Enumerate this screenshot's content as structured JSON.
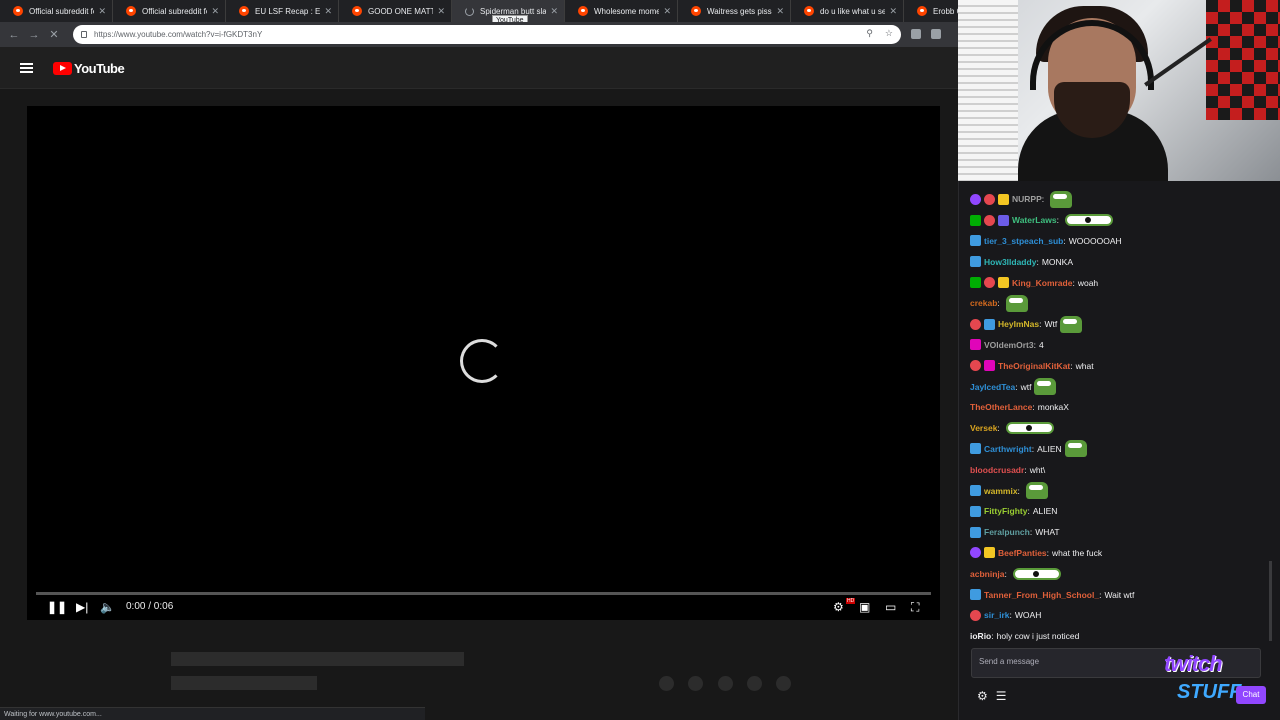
{
  "browser": {
    "tabs": [
      {
        "title": "Official subreddit fo",
        "icon": "reddit-icon",
        "active": false
      },
      {
        "title": "Official subreddit fo",
        "icon": "reddit-icon",
        "active": false
      },
      {
        "title": "EU LSF Recap : Esfa",
        "icon": "reddit-icon",
        "active": false
      },
      {
        "title": "GOOD ONE MATTH",
        "icon": "reddit-icon",
        "active": false
      },
      {
        "title": "Spiderman butt slap",
        "icon": "loading-spinner",
        "active": true
      },
      {
        "title": "Wholesome mome",
        "icon": "reddit-icon",
        "active": false
      },
      {
        "title": "Waitress gets pisse",
        "icon": "reddit-icon",
        "active": false
      },
      {
        "title": "do u like what u se",
        "icon": "reddit-icon",
        "active": false
      },
      {
        "title": "Erobb C",
        "icon": "reddit-icon",
        "active": false
      }
    ],
    "tooltip": "YouTube",
    "url": "https://www.youtube.com/watch?v=i-fGKDT3nY",
    "status": "Waiting for www.youtube.com..."
  },
  "youtube": {
    "logo_text": "YouTube",
    "player": {
      "time": "0:00 / 0:06",
      "progress": 0,
      "hd_badge": "HD"
    }
  },
  "chat": {
    "messages": [
      {
        "user": "NURPP",
        "color": "#9e9e9e",
        "badges": [
          "b-prime",
          "b-g",
          "b-bits"
        ],
        "text": "",
        "emote": "emote"
      },
      {
        "user": "WaterLaws",
        "color": "#3fbf7f",
        "badges": [
          "b-mod",
          "b-g",
          "b-gift"
        ],
        "text": "",
        "emote": "emote-wide"
      },
      {
        "user": "tier_3_stpeach_sub",
        "color": "#2e8fd6",
        "badges": [
          "b-sub"
        ],
        "text": "WOOOOOAH",
        "emote": ""
      },
      {
        "user": "How3lldaddy",
        "color": "#2eb6b6",
        "badges": [
          "b-sub"
        ],
        "text": "MONKA",
        "emote": ""
      },
      {
        "user": "King_Komrade",
        "color": "#e0603a",
        "badges": [
          "b-mod",
          "b-g",
          "b-bits"
        ],
        "text": "woah",
        "emote": ""
      },
      {
        "user": "crekab",
        "color": "#d2691e",
        "badges": [],
        "text": "",
        "emote": "emote"
      },
      {
        "user": "HeyImNas",
        "color": "#d4b72a",
        "badges": [
          "b-g",
          "b-sub"
        ],
        "text": "Wtf",
        "emote": "emote"
      },
      {
        "user": "VOldemOrt3",
        "color": "#9e9e9e",
        "badges": [
          "b-vip"
        ],
        "text": "4",
        "emote": ""
      },
      {
        "user": "TheOriginalKitKat",
        "color": "#e0603a",
        "badges": [
          "b-g",
          "b-vip"
        ],
        "text": "what",
        "emote": ""
      },
      {
        "user": "JayIcedTea",
        "color": "#2e8fd6",
        "badges": [],
        "text": "wtf",
        "emote": "emote"
      },
      {
        "user": "TheOtherLance",
        "color": "#e0603a",
        "badges": [],
        "text": "monkaX",
        "emote": ""
      },
      {
        "user": "Versek",
        "color": "#daa520",
        "badges": [],
        "text": "",
        "emote": "emote-wide"
      },
      {
        "user": "Carthwright",
        "color": "#2e8fd6",
        "badges": [
          "b-sub"
        ],
        "text": "ALIEN",
        "emote": "emote"
      },
      {
        "user": "bloodcrusadr",
        "color": "#e05050",
        "badges": [],
        "text": "wht\\",
        "emote": ""
      },
      {
        "user": "wammix",
        "color": "#d4b72a",
        "badges": [
          "b-sub"
        ],
        "text": "",
        "emote": "emote"
      },
      {
        "user": "FittyFighty",
        "color": "#9acd32",
        "badges": [
          "b-sub"
        ],
        "text": "ALIEN",
        "emote": ""
      },
      {
        "user": "Feralpunch",
        "color": "#5f9ea0",
        "badges": [
          "b-sub"
        ],
        "text": "WHAT",
        "emote": ""
      },
      {
        "user": "BeefPanties",
        "color": "#e0603a",
        "badges": [
          "b-prime",
          "b-bits"
        ],
        "text": "what the fuck",
        "emote": ""
      },
      {
        "user": "acbninja",
        "color": "#e0603a",
        "badges": [],
        "text": "",
        "emote": "emote-wide"
      },
      {
        "user": "Tanner_From_High_School_",
        "color": "#e0603a",
        "badges": [
          "b-sub"
        ],
        "text": "Wait wtf",
        "emote": ""
      },
      {
        "user": "sir_irk",
        "color": "#2e8fd6",
        "badges": [
          "b-g"
        ],
        "text": "WOAH",
        "emote": ""
      },
      {
        "user": "ioRio",
        "color": "#efeff1",
        "badges": [],
        "text": "holy cow i just noticed",
        "emote": ""
      }
    ],
    "input_placeholder": "Send a message",
    "chat_button": "Chat",
    "overlay_logo_top": "twitch",
    "overlay_logo_bottom": "STUFF"
  }
}
